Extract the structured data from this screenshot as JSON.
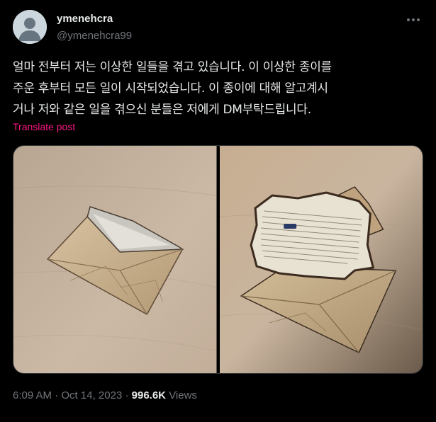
{
  "author": {
    "display_name": "ymenehcra",
    "handle": "@ymenehcra99",
    "avatar_icon": "default-avatar-icon"
  },
  "more_icon": "more-horizontal-icon",
  "tweet": {
    "lines": [
      "얼마 전부터 저는 이상한 일들을 겪고 있습니다. 이 이상한 종이를",
      "주운 후부터 모든 일이 시작되었습니다. 이 종이에 대해 알고계시",
      "거나 저와 같은 일을 겪으신 분들은 저에게 DM부탁드립니다."
    ],
    "translate_label": "Translate post"
  },
  "media": {
    "photos": [
      {
        "name": "envelope-closed-photo"
      },
      {
        "name": "envelope-open-photo"
      }
    ]
  },
  "meta": {
    "time": "6:09 AM",
    "separator": "·",
    "date": "Oct 14, 2023",
    "views_count": "996.6K",
    "views_label": "Views"
  },
  "colors": {
    "background": "#000000",
    "text": "#e7e9ea",
    "muted": "#71767b",
    "link": "#f91880",
    "border": "#2f3336"
  }
}
